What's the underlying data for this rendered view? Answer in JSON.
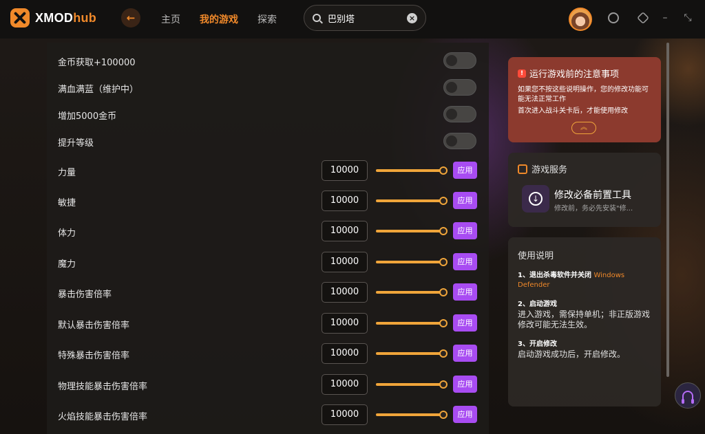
{
  "app": {
    "logo_text": "XMOD",
    "logo_hub": "hub"
  },
  "nav": {
    "back_icon": "arrow-left-icon",
    "items": [
      {
        "label": "主页",
        "active": false
      },
      {
        "label": "我的游戏",
        "active": true
      },
      {
        "label": "探索",
        "active": false
      }
    ]
  },
  "search": {
    "value": "巴别塔",
    "clear_symbol": "×"
  },
  "window_controls": {
    "minimize": "–",
    "close": "⤡"
  },
  "accent_color": "#f0892a",
  "apply_color": "#a84cf2",
  "toggles": [
    {
      "label": "金币获取+100000",
      "on": false
    },
    {
      "label": "满血满蓝（维护中）",
      "on": false
    },
    {
      "label": "增加5000金币",
      "on": false
    },
    {
      "label": "提升等级",
      "on": false
    }
  ],
  "sliders": [
    {
      "label": "力量",
      "value": "10000",
      "apply": "应用"
    },
    {
      "label": "敏捷",
      "value": "10000",
      "apply": "应用"
    },
    {
      "label": "体力",
      "value": "10000",
      "apply": "应用"
    },
    {
      "label": "魔力",
      "value": "10000",
      "apply": "应用"
    },
    {
      "label": "暴击伤害倍率",
      "value": "10000",
      "apply": "应用"
    },
    {
      "label": "默认暴击伤害倍率",
      "value": "10000",
      "apply": "应用"
    },
    {
      "label": "特殊暴击伤害倍率",
      "value": "10000",
      "apply": "应用"
    },
    {
      "label": "物理技能暴击伤害倍率",
      "value": "10000",
      "apply": "应用"
    },
    {
      "label": "火焰技能暴击伤害倍率",
      "value": "10000",
      "apply": "应用"
    }
  ],
  "notice": {
    "title": "运行游戏前的注意事项",
    "line1": "如果您不按这些说明操作，您的修改功能可能无法正常工作",
    "line2": "首次进入战斗关卡后，才能使用修改",
    "expand_symbol": "︽"
  },
  "services": {
    "title": "游戏服务",
    "tool_name": "修改必备前置工具",
    "tool_desc": "修改前，务必先安装\"修..."
  },
  "usage": {
    "title": "使用说明",
    "step1_head": "1、退出杀毒软件并关闭 ",
    "step1_highlight": "Windows Defender",
    "step2_head": "2、启动游戏",
    "step2_body": "进入游戏，需保持单机；非正版游戏修改可能无法生效。",
    "step3_head": "3、开启修改",
    "step3_body": "启动游戏成功后，开启修改。"
  }
}
